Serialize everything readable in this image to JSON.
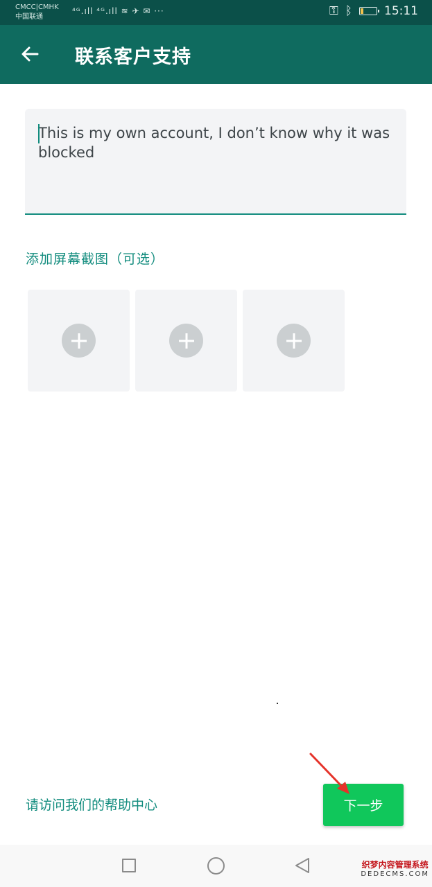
{
  "status_bar": {
    "carrier_line1": "CMCC|CMHK",
    "carrier_line2": "中国联通",
    "icons_text": "⁴ᴳ.ıll ⁴ᴳ.ıll ≋ ✈ ✉ ···",
    "key_icon": "⚿",
    "bluetooth_icon": "ᛒ",
    "battery_level": 0.2,
    "time": "15:11"
  },
  "app_bar": {
    "title": "联系客户支持",
    "background": "#0f6b5f"
  },
  "message": {
    "value": "This is my own account, I don’t know why it was blocked"
  },
  "screenshots": {
    "label": "添加屏幕截图（可选）",
    "tiles": 3
  },
  "footer": {
    "help_link": "请访问我们的帮助中心",
    "next_label": "下一步",
    "next_color": "#10c75b"
  },
  "watermark": {
    "cn": "织梦内容管理系统",
    "en": "DEDECMS.COM"
  }
}
